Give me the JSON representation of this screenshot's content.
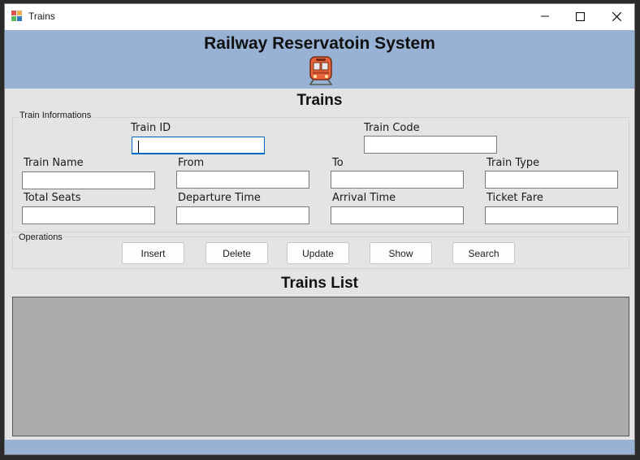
{
  "window": {
    "title": "Trains",
    "controls": [
      "minimize",
      "maximize",
      "close"
    ]
  },
  "header": {
    "app_title": "Railway Reservatoin System",
    "logo_icon": "train-icon"
  },
  "section_title": "Trains",
  "train_info": {
    "group_label": "Train Informations",
    "fields": {
      "train_id": {
        "label": "Train ID",
        "value": ""
      },
      "train_code": {
        "label": "Train Code",
        "value": ""
      },
      "train_name": {
        "label": "Train Name",
        "value": ""
      },
      "from": {
        "label": "From",
        "value": ""
      },
      "to": {
        "label": "To",
        "value": ""
      },
      "train_type": {
        "label": "Train Type",
        "value": ""
      },
      "total_seats": {
        "label": "Total Seats",
        "value": ""
      },
      "departure_time": {
        "label": "Departure Time",
        "value": ""
      },
      "arrival_time": {
        "label": "Arrival Time",
        "value": ""
      },
      "ticket_fare": {
        "label": "Ticket Fare",
        "value": ""
      }
    }
  },
  "operations": {
    "group_label": "Operations",
    "buttons": {
      "insert": "Insert",
      "delete": "Delete",
      "update": "Update",
      "show": "Show",
      "search": "Search"
    }
  },
  "list_title": "Trains List",
  "colors": {
    "header_bg": "#97b2d4",
    "form_bg": "#e4e4e4",
    "grid_bg": "#ababab",
    "focus_accent": "#0067c0",
    "logo_orange": "#e8643a"
  }
}
